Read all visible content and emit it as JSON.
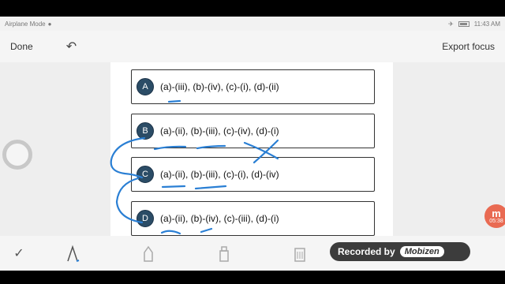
{
  "status_bar": {
    "left_text": "Airplane Mode",
    "time": "11:43 AM"
  },
  "toolbar": {
    "done_label": "Done",
    "export_label": "Export focus"
  },
  "options": [
    {
      "letter": "A",
      "text": "(a)-(iii), (b)-(iv), (c)-(i), (d)-(ii)"
    },
    {
      "letter": "B",
      "text": "(a)-(ii), (b)-(iii), (c)-(iv), (d)-(i)"
    },
    {
      "letter": "C",
      "text": "(a)-(ii), (b)-(iii), (c)-(i), (d)-(iv)"
    },
    {
      "letter": "D",
      "text": "(a)-(ii), (b)-(iv), (c)-(iii), (d)-(i)"
    }
  ],
  "floating_badge": {
    "letter": "m",
    "time": "05:38"
  },
  "watermark": {
    "prefix": "Recorded by",
    "brand": "Mobizen"
  },
  "colors": {
    "ink": "#2a7fd4",
    "badge": "#2b4c66",
    "recorder": "#e96a52"
  },
  "icons": {
    "undo": "undo-icon",
    "confirm": "check-icon",
    "pen": "pen-icon",
    "marker": "marker-icon",
    "highlighter": "highlighter-icon",
    "eraser": "eraser-icon"
  }
}
